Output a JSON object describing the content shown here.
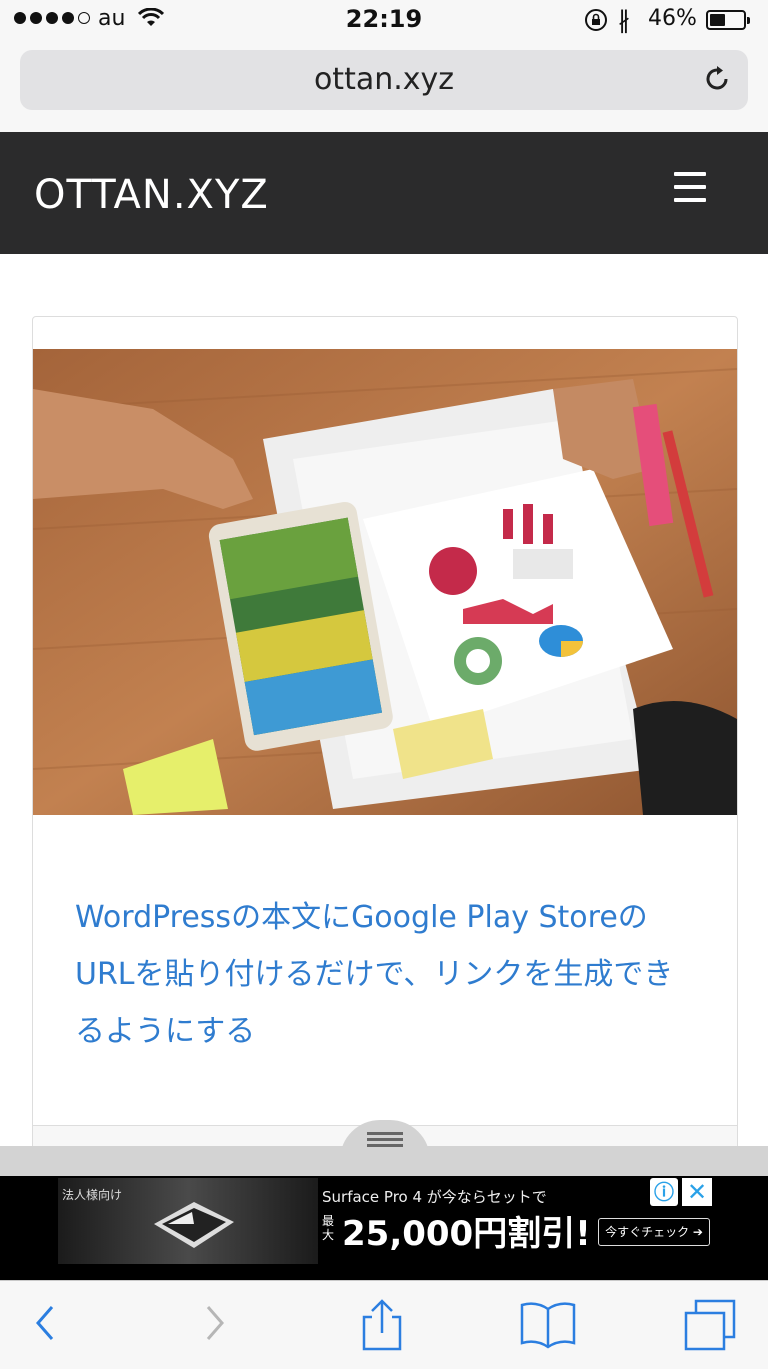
{
  "status_bar": {
    "carrier": "au",
    "time": "22:19",
    "battery": "46%",
    "battery_level": 0.46
  },
  "browser": {
    "url": "ottan.xyz"
  },
  "site": {
    "logo": "OTTAN.XYZ"
  },
  "post": {
    "title": "WordPressの本文にGoogle Play StoreのURLを貼り付けるだけで、リンクを生成できるようにする"
  },
  "ad": {
    "tag": "法人様向け",
    "headline": "Surface Pro 4 が今ならセットで",
    "prefix": "最大",
    "amount": "25,000円割引!",
    "cta": "今すぐチェック ➔",
    "info": "ⓘ",
    "close": "✕"
  },
  "icons": {
    "wifi": "wifi-icon",
    "lock": "orientation-lock-icon",
    "bluetooth": "bluetooth-icon",
    "reload": "reload-icon",
    "menu": "hamburger-menu-icon",
    "back": "back-chevron-icon",
    "forward": "forward-chevron-icon",
    "share": "share-icon",
    "bookmarks": "bookmarks-icon",
    "tabs": "tabs-icon"
  },
  "colors": {
    "header_bg": "#2b2b2c",
    "link": "#2f7ccf",
    "ios_blue": "#2b7ee0"
  }
}
